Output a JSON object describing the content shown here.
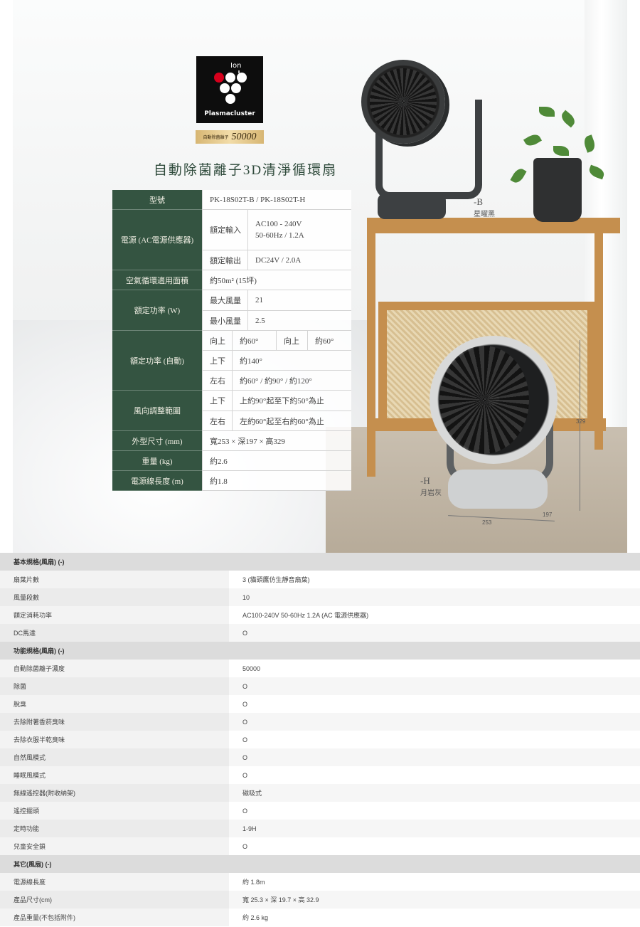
{
  "hero": {
    "logo": {
      "ion": "Ion",
      "word": "Plasmacluster"
    },
    "badge": {
      "label": "自動除菌離子",
      "value": "50000"
    },
    "title": "自動除菌離子3D清淨循環扇",
    "variants": [
      {
        "code": "-B",
        "name": "星曜黑"
      },
      {
        "code": "-H",
        "name": "月岩灰"
      }
    ],
    "dimensions": {
      "height": "329",
      "width": "253",
      "depth": "197"
    },
    "spec": {
      "model_label": "型號",
      "model_value": "PK-18S02T-B / PK-18S02T-H",
      "power_label": "電源 (AC電源供應器)",
      "input_label": "額定輸入",
      "input_value_1": "AC100 - 240V",
      "input_value_2": "50-60Hz / 1.2A",
      "output_label": "額定輸出",
      "output_value": "DC24V / 2.0A",
      "area_label": "空氣循環適用面積",
      "area_value": "約50m² (15坪)",
      "watt_label": "額定功率 (W)",
      "watt_max_label": "最大風量",
      "watt_max_value": "21",
      "watt_min_label": "最小風量",
      "watt_min_value": "2.5",
      "auto_label": "額定功率 (自動)",
      "auto_up_label": "向上",
      "auto_up_value": "約60°",
      "auto_up_label_2": "向上",
      "auto_up_value_2": "約60°",
      "auto_ud_label": "上下",
      "auto_ud_value": "約140°",
      "auto_lr_label": "左右",
      "auto_lr_value": "約60° / 約90° / 約120°",
      "dir_label": "風向調整範圍",
      "dir_ud_label": "上下",
      "dir_ud_value": "上約90°起至下約50°為止",
      "dir_lr_label": "左右",
      "dir_lr_value": "左約60°起至右約60°為止",
      "size_label": "外型尺寸 (mm)",
      "size_value": "寬253 × 深197 × 高329",
      "weight_label": "重量 (kg)",
      "weight_value": "約2.6",
      "cord_label": "電源線長度 (m)",
      "cord_value": "約1.8"
    }
  },
  "table": {
    "sections": [
      {
        "title": "基本規格(風扇) (-)",
        "rows": [
          {
            "key": "扇葉片數",
            "value": "3 (貓頭鷹仿生靜音扇葉)"
          },
          {
            "key": "風量段數",
            "value": "10"
          },
          {
            "key": "額定消耗功率",
            "value": "AC100-240V 50-60Hz 1.2A (AC 電源供應器)"
          },
          {
            "key": "DC馬達",
            "value": "O"
          }
        ]
      },
      {
        "title": "功能規格(風扇) (-)",
        "rows": [
          {
            "key": "自動除菌離子濃度",
            "value": "50000"
          },
          {
            "key": "除菌",
            "value": "O"
          },
          {
            "key": "脫臭",
            "value": "O"
          },
          {
            "key": "去除附著香菸臭味",
            "value": "O"
          },
          {
            "key": "去除衣服半乾臭味",
            "value": "O"
          },
          {
            "key": "自然風模式",
            "value": "O"
          },
          {
            "key": "睡眠風模式",
            "value": "O"
          },
          {
            "key": "無線遙控器(附收納架)",
            "value": "磁吸式"
          },
          {
            "key": "遙控擺頭",
            "value": "O"
          },
          {
            "key": "定時功能",
            "value": "1-9H"
          },
          {
            "key": "兒童安全鎖",
            "value": "O"
          }
        ]
      },
      {
        "title": "其它(風扇) (-)",
        "rows": [
          {
            "key": "電源線長度",
            "value": "約 1.8m"
          },
          {
            "key": "產品尺寸(cm)",
            "value": "寬 25.3 × 深 19.7 × 高 32.9"
          },
          {
            "key": "產品重量(不包括附件)",
            "value": "約 2.6 kg"
          }
        ]
      }
    ]
  }
}
